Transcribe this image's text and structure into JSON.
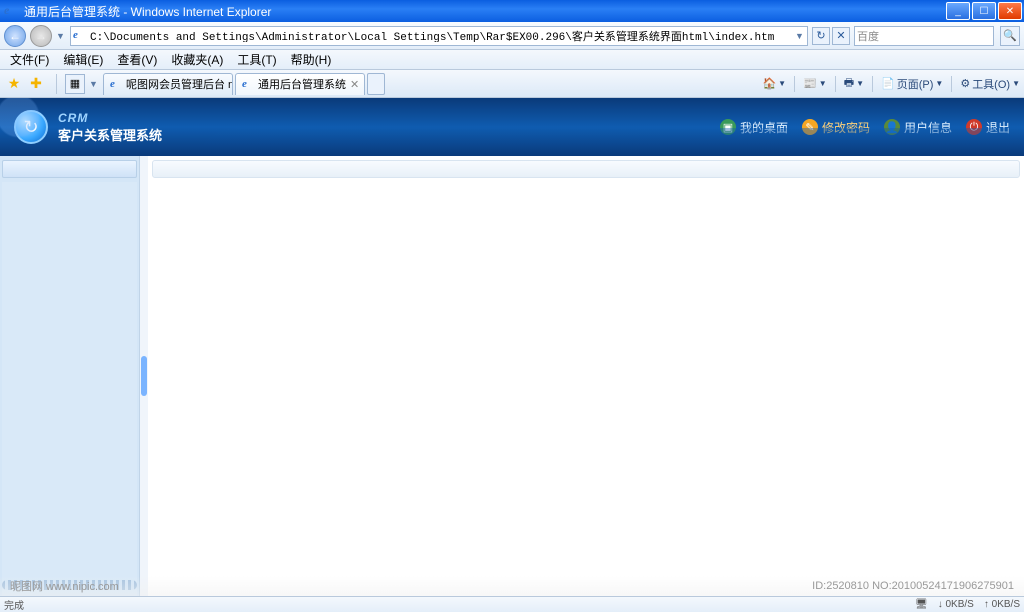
{
  "window": {
    "title": "通用后台管理系统 - Windows Internet Explorer",
    "min": "_",
    "max": "☐",
    "close": "✕"
  },
  "nav": {
    "back": "←",
    "fwd": "→",
    "address": "C:\\Documents and Settings\\Administrator\\Local Settings\\Temp\\Rar$EX00.296\\客户关系管理系统界面html\\index.htm",
    "refresh": "↻",
    "stop": "✕",
    "search_placeholder": "百度",
    "search_go": "🔍"
  },
  "menu": {
    "items": [
      "文件(F)",
      "编辑(E)",
      "查看(V)",
      "收藏夹(A)",
      "工具(T)",
      "帮助(H)"
    ]
  },
  "toolbar": {
    "tabs": [
      {
        "label": "呢图网会员管理后台 nip..."
      },
      {
        "label": "通用后台管理系统"
      }
    ],
    "cmd": {
      "page": "页面(P)",
      "tools": "工具(O)"
    }
  },
  "crm": {
    "tag": "CRM",
    "name": "客户关系管理系统",
    "actions": {
      "desktop": "我的桌面",
      "password": "修改密码",
      "userinfo": "用户信息",
      "logout": "退出"
    }
  },
  "status": {
    "left": "完成",
    "net1": "0KB/S",
    "net2": "0KB/S"
  },
  "watermark": {
    "site": "昵图网 www.nipic.com",
    "id": "ID:2520810 NO:20100524171906275901"
  }
}
